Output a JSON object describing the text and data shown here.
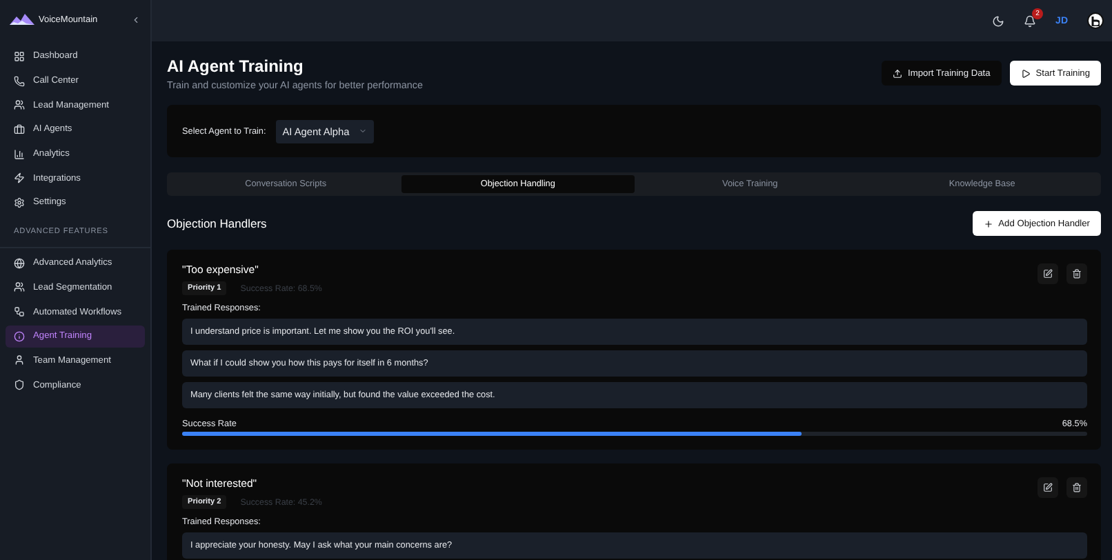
{
  "brand": {
    "name": "VoiceMountain"
  },
  "sidebar": {
    "items": [
      {
        "label": "Dashboard",
        "selected": false
      },
      {
        "label": "Call Center",
        "selected": false
      },
      {
        "label": "Lead Management",
        "selected": false
      },
      {
        "label": "AI Agents",
        "selected": false
      },
      {
        "label": "Analytics",
        "selected": false
      },
      {
        "label": "Integrations",
        "selected": false
      },
      {
        "label": "Settings",
        "selected": false
      }
    ],
    "section_title": "ADVANCED FEATURES",
    "advanced_items": [
      {
        "label": "Advanced Analytics",
        "selected": false
      },
      {
        "label": "Lead Segmentation",
        "selected": false
      },
      {
        "label": "Automated Workflows",
        "selected": false
      },
      {
        "label": "Agent Training",
        "selected": true
      },
      {
        "label": "Team Management",
        "selected": false
      },
      {
        "label": "Compliance",
        "selected": false
      }
    ]
  },
  "header": {
    "notifications": "2",
    "avatar": "JD"
  },
  "page": {
    "title": "AI Agent Training",
    "subtitle": "Train and customize your AI agents for better performance",
    "buttons": [
      {
        "label": "Import Training Data",
        "kind": "secondary"
      },
      {
        "label": "Start Training",
        "kind": "primary"
      }
    ]
  },
  "agent_select": {
    "label": "Select Agent to Train:",
    "value": "AI Agent Alpha"
  },
  "tabs": [
    {
      "label": "Conversation Scripts",
      "selected": false
    },
    {
      "label": "Objection Handling",
      "selected": true
    },
    {
      "label": "Voice Training",
      "selected": false
    },
    {
      "label": "Knowledge Base",
      "selected": false
    }
  ],
  "section": {
    "title": "Objection Handlers",
    "add_button": "Add Objection Handler"
  },
  "handlers": [
    {
      "objection": "\"Too expensive\"",
      "priority": "Priority 1",
      "success_text": "Success Rate: 68.5%",
      "responses_label": "Trained Responses:",
      "responses": [
        "I understand price is important. Let me show you the ROI you'll see.",
        "What if I could show you how this pays for itself in 6 months?",
        "Many clients felt the same way initially, but found the value exceeded the cost."
      ],
      "rate_label": "Success Rate",
      "rate_value": "68.5%",
      "level": 0.685
    },
    {
      "objection": "\"Not interested\"",
      "priority": "Priority 2",
      "success_text": "Success Rate: 45.2%",
      "responses_label": "Trained Responses:",
      "responses": [
        "I appreciate your honesty. May I ask what your main concerns are?"
      ]
    }
  ]
}
